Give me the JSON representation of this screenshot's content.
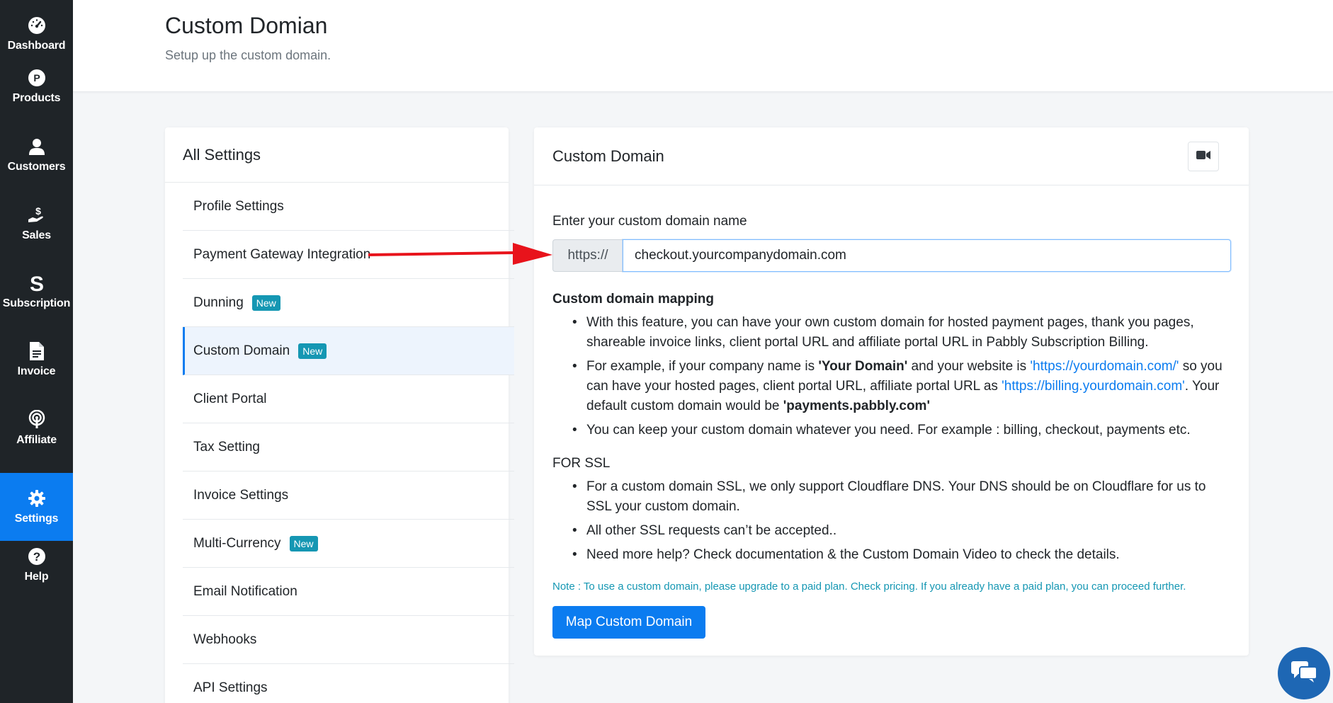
{
  "sidebar": {
    "items": [
      {
        "label": "Dashboard",
        "icon": "dashboard-icon"
      },
      {
        "label": "Products",
        "icon": "products-icon"
      },
      {
        "label": "Customers",
        "icon": "user-icon"
      },
      {
        "label": "Sales",
        "icon": "sales-icon"
      },
      {
        "label": "Subscription",
        "icon": "subscription-icon"
      },
      {
        "label": "Invoice",
        "icon": "invoice-icon"
      },
      {
        "label": "Affiliate",
        "icon": "affiliate-icon"
      },
      {
        "label": "Settings",
        "icon": "gear-icon",
        "active": true
      },
      {
        "label": "Help",
        "icon": "help-icon"
      }
    ]
  },
  "header": {
    "title": "Custom Domian",
    "subtitle": "Setup up the custom domain."
  },
  "settings": {
    "title": "All Settings",
    "items": [
      {
        "label": "Profile Settings"
      },
      {
        "label": "Payment Gateway Integration"
      },
      {
        "label": "Dunning",
        "badge": "New"
      },
      {
        "label": "Custom Domain",
        "badge": "New",
        "active": true
      },
      {
        "label": "Client Portal"
      },
      {
        "label": "Tax Setting"
      },
      {
        "label": "Invoice Settings"
      },
      {
        "label": "Multi-Currency",
        "badge": "New"
      },
      {
        "label": "Email Notification"
      },
      {
        "label": "Webhooks"
      },
      {
        "label": "API Settings"
      }
    ]
  },
  "main": {
    "title": "Custom Domain",
    "field_label": "Enter your custom domain name",
    "prefix": "https://",
    "domain_value": "checkout.yourcompanydomain.com",
    "mapping_title": "Custom domain mapping",
    "mapping": {
      "b1": "With this feature, you can have your own custom domain for hosted payment pages, thank you pages, shareable invoice links, client portal URL and affiliate portal URL in Pabbly Subscription Billing.",
      "b2_a": "For example, if your company name is ",
      "b2_b": "'Your Domain'",
      "b2_c": " and your website is ",
      "b2_d": "'https://yourdomain.com/'",
      "b2_e": " so you can have your hosted pages, client portal URL, affiliate portal URL as ",
      "b2_f": "'https://billing.yourdomain.com'",
      "b2_g": ". Your default custom domain would be ",
      "b2_h": "'payments.pabbly.com'",
      "b3": "You can keep your custom domain whatever you need. For example : billing, checkout, payments etc."
    },
    "ssl_title": "FOR SSL",
    "ssl": {
      "b1": "For a custom domain SSL, we only support Cloudflare DNS. Your DNS should be on Cloudflare for us to SSL your custom domain.",
      "b2": "All other SSL requests can’t be accepted..",
      "b3": "Need more help? Check documentation & the Custom Domain Video to check the details."
    },
    "note": "Note : To use a custom domain, please upgrade to a paid plan. Check pricing. If you already have a paid plan, you can proceed further.",
    "button": "Map Custom Domain"
  },
  "colors": {
    "accent": "#0b7cf0",
    "sidebar": "#1f2428",
    "badge": "#1597b3",
    "arrow": "#e8131b"
  }
}
